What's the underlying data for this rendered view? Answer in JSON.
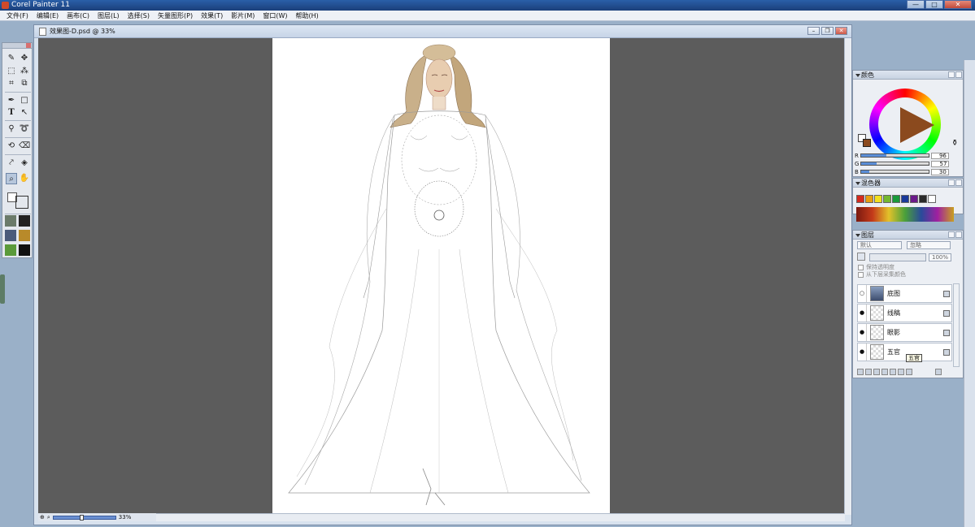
{
  "app": {
    "title": "Corel Painter 11"
  },
  "window_buttons": {
    "minimize": "—",
    "maximize": "□",
    "close": "✕"
  },
  "menu": [
    "文件(F)",
    "编辑(E)",
    "画布(C)",
    "图层(L)",
    "选择(S)",
    "矢量图形(P)",
    "效果(T)",
    "影片(M)",
    "窗口(W)",
    "帮助(H)"
  ],
  "document": {
    "title": "效果图-D.psd @ 33%",
    "zoom_label": "33%",
    "zoom_fraction": 0.45
  },
  "toolbox": {
    "tools": [
      "brush-icon",
      "layer-adjuster-icon",
      "rect-select-icon",
      "magic-wand-icon",
      "crop-icon",
      "transform-icon",
      "pen-icon",
      "rect-shape-icon",
      "text-icon",
      "shape-select-icon",
      "lasso-icon",
      "rotate-page-icon",
      "dropper-icon",
      "eraser-icon",
      "cloner-icon",
      "bucket-icon",
      "magnifier-icon",
      "grabber-icon"
    ],
    "primary_color": "#ffffff",
    "additional_color": "#8b4a1e"
  },
  "colors_panel": {
    "title": "颜色",
    "current_color": "#8b4a1e",
    "r_label": "R",
    "r_value": "96",
    "g_label": "G",
    "g_value": "57",
    "b_label": "B",
    "b_value": "30"
  },
  "mixer_panel": {
    "title": "混色器",
    "palette": [
      "#d42a1e",
      "#e8a010",
      "#f2e020",
      "#74b830",
      "#1a9a3a",
      "#1a3a9a",
      "#6a1a8a",
      "#2a2a2a",
      "#ffffff"
    ]
  },
  "layers_panel": {
    "title": "图层",
    "composite_method": "默认",
    "depth": "忽略",
    "opacity": "100%",
    "preserve_transparency": "保持透明度",
    "pick_up_color": "从下层采集颜色",
    "layers": [
      {
        "name": "底图",
        "visible": false,
        "thumb": "photo"
      },
      {
        "name": "线稿",
        "visible": true,
        "thumb": "transparent"
      },
      {
        "name": "眼影",
        "visible": true,
        "thumb": "transparent"
      },
      {
        "name": "五官",
        "visible": true,
        "thumb": "transparent"
      }
    ],
    "tooltip": "五官"
  }
}
